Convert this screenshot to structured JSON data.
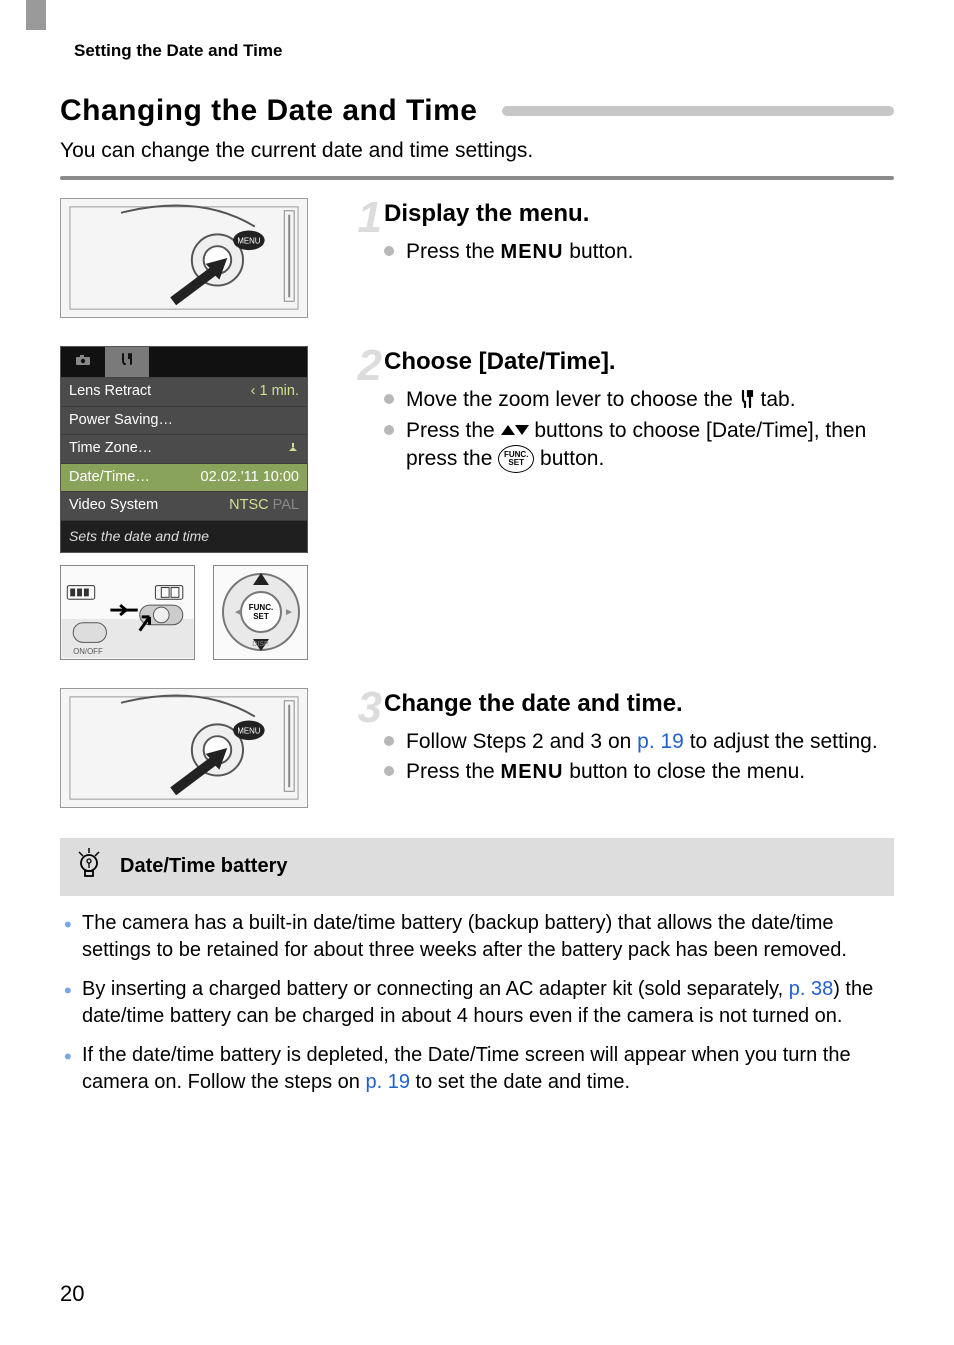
{
  "running_head": "Setting the Date and Time",
  "h1": "Changing the Date and Time",
  "intro": "You can change the current date and time settings.",
  "page_number": "20",
  "steps": [
    {
      "num": "1",
      "title": "Display the menu.",
      "bullets": [
        {
          "pre": "Press the ",
          "icon": "MENU",
          "post": " button."
        }
      ]
    },
    {
      "num": "2",
      "title": "Choose [Date/Time].",
      "bullets": [
        {
          "pre": "Move the zoom lever to choose the ",
          "icon": "tools-tab",
          "post": " tab."
        },
        {
          "pre": "Press the ",
          "icon": "up-down",
          "post_a": " buttons to choose [Date/Time], then press the ",
          "icon2": "func-set",
          "post_b": " button."
        }
      ]
    },
    {
      "num": "3",
      "title": "Change the date and time.",
      "bullets": [
        {
          "pre": "Follow Steps 2 and 3 on ",
          "link": "p. 19",
          "post": " to adjust the setting."
        },
        {
          "pre": "Press the ",
          "icon": "MENU",
          "post": " button to close the menu."
        }
      ]
    }
  ],
  "menu_shot": {
    "tabs": {
      "camera": "camera",
      "tools": "tools"
    },
    "rows": [
      {
        "key": "Lens Retract",
        "val": "‹ 1 min."
      },
      {
        "key": "Power Saving…",
        "val": ""
      },
      {
        "key": "Time Zone…",
        "val": "home"
      },
      {
        "key": "Date/Time…",
        "val": "02.02.'11 10:00",
        "selected": true
      },
      {
        "key": "Video System",
        "val": "NTSC"
      }
    ],
    "footer": "Sets the date and time"
  },
  "tip": {
    "title": "Date/Time battery",
    "items": [
      {
        "text_a": "The camera has a built-in date/time battery (backup battery) that allows the date/time settings to be retained for about three weeks after the battery pack has been removed."
      },
      {
        "text_a": "By inserting a charged battery or connecting an AC adapter kit (sold separately, ",
        "link": "p. 38",
        "text_b": ") the date/time battery can be charged in about 4 hours even if the camera is not turned on."
      },
      {
        "text_a": "If the date/time battery is depleted, the Date/Time screen will appear when you turn the camera on. Follow the steps on ",
        "link": "p. 19",
        "text_b": " to set the date and time."
      }
    ]
  }
}
